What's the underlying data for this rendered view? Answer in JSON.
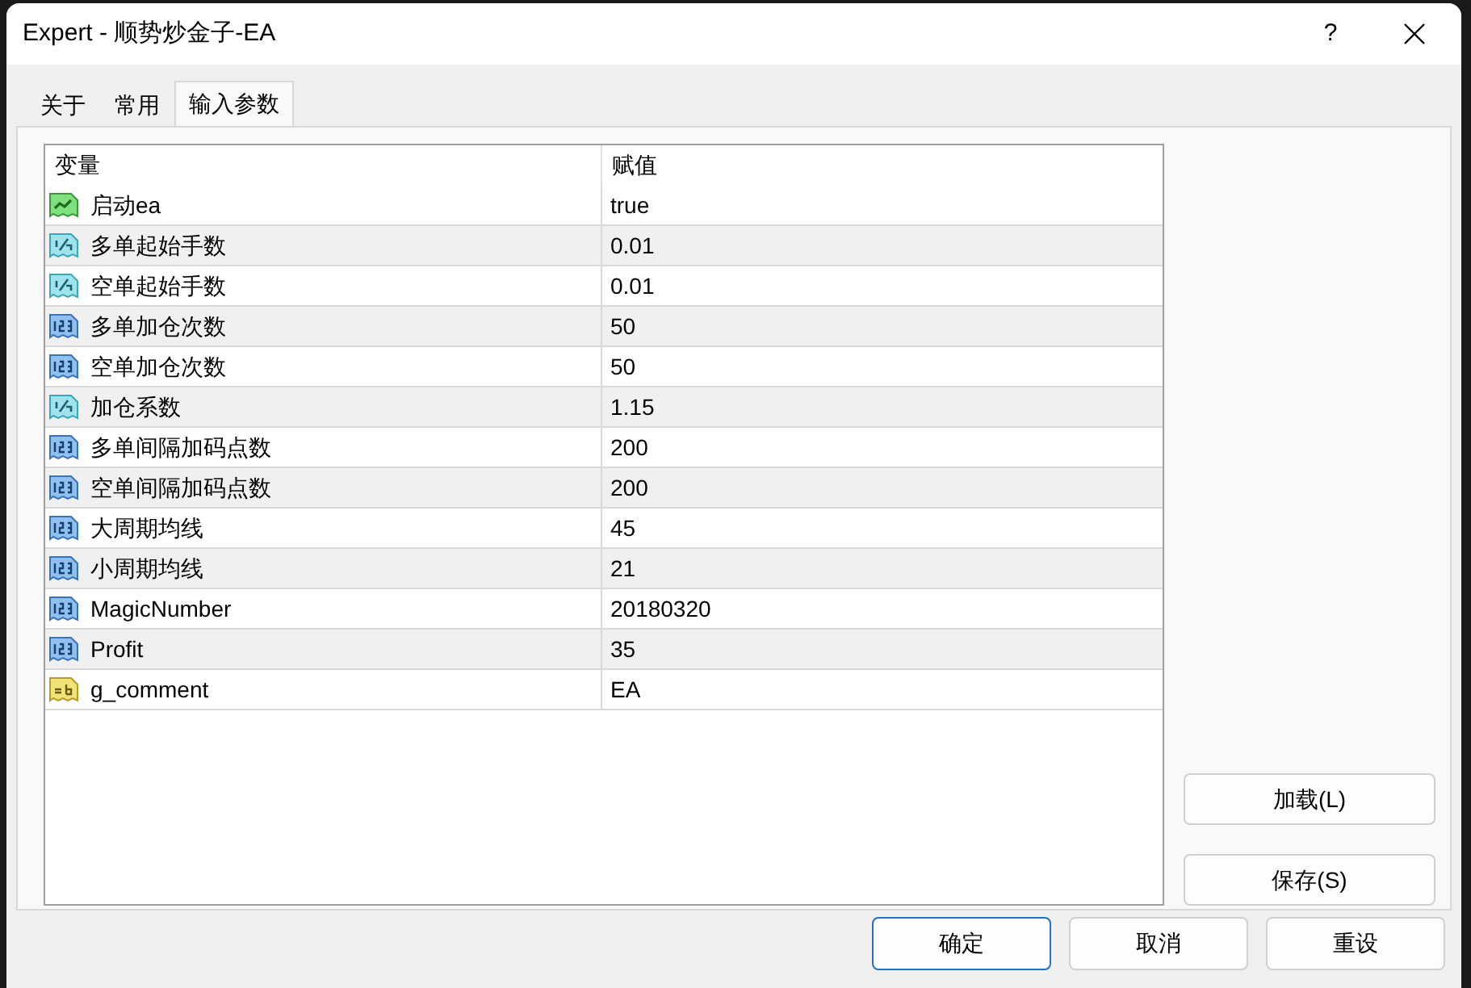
{
  "window": {
    "title": "Expert - 顺势炒金子-EA",
    "help": "?"
  },
  "tabs": [
    {
      "label": "关于",
      "selected": false
    },
    {
      "label": "常用",
      "selected": false
    },
    {
      "label": "输入参数",
      "selected": true
    }
  ],
  "table": {
    "columns": [
      "变量",
      "赋值"
    ],
    "rows": [
      {
        "kind": "bool",
        "name": "启动ea",
        "value": "true"
      },
      {
        "kind": "double",
        "name": "多单起始手数",
        "value": "0.01"
      },
      {
        "kind": "double",
        "name": "空单起始手数",
        "value": "0.01"
      },
      {
        "kind": "int",
        "name": "多单加仓次数",
        "value": "50"
      },
      {
        "kind": "int",
        "name": "空单加仓次数",
        "value": "50"
      },
      {
        "kind": "double",
        "name": "加仓系数",
        "value": "1.15"
      },
      {
        "kind": "int",
        "name": "多单间隔加码点数",
        "value": "200"
      },
      {
        "kind": "int",
        "name": "空单间隔加码点数",
        "value": "200"
      },
      {
        "kind": "int",
        "name": "大周期均线",
        "value": "45"
      },
      {
        "kind": "int",
        "name": "小周期均线",
        "value": "21"
      },
      {
        "kind": "int",
        "name": "MagicNumber",
        "value": "20180320"
      },
      {
        "kind": "int",
        "name": "Profit",
        "value": "35"
      },
      {
        "kind": "string",
        "name": "g_comment",
        "value": "EA"
      }
    ]
  },
  "side_buttons": [
    "加载(L)",
    "保存(S)"
  ],
  "buttons": [
    {
      "label": "确定",
      "default": true
    },
    {
      "label": "取消",
      "default": false
    },
    {
      "label": "重设",
      "default": false
    }
  ]
}
